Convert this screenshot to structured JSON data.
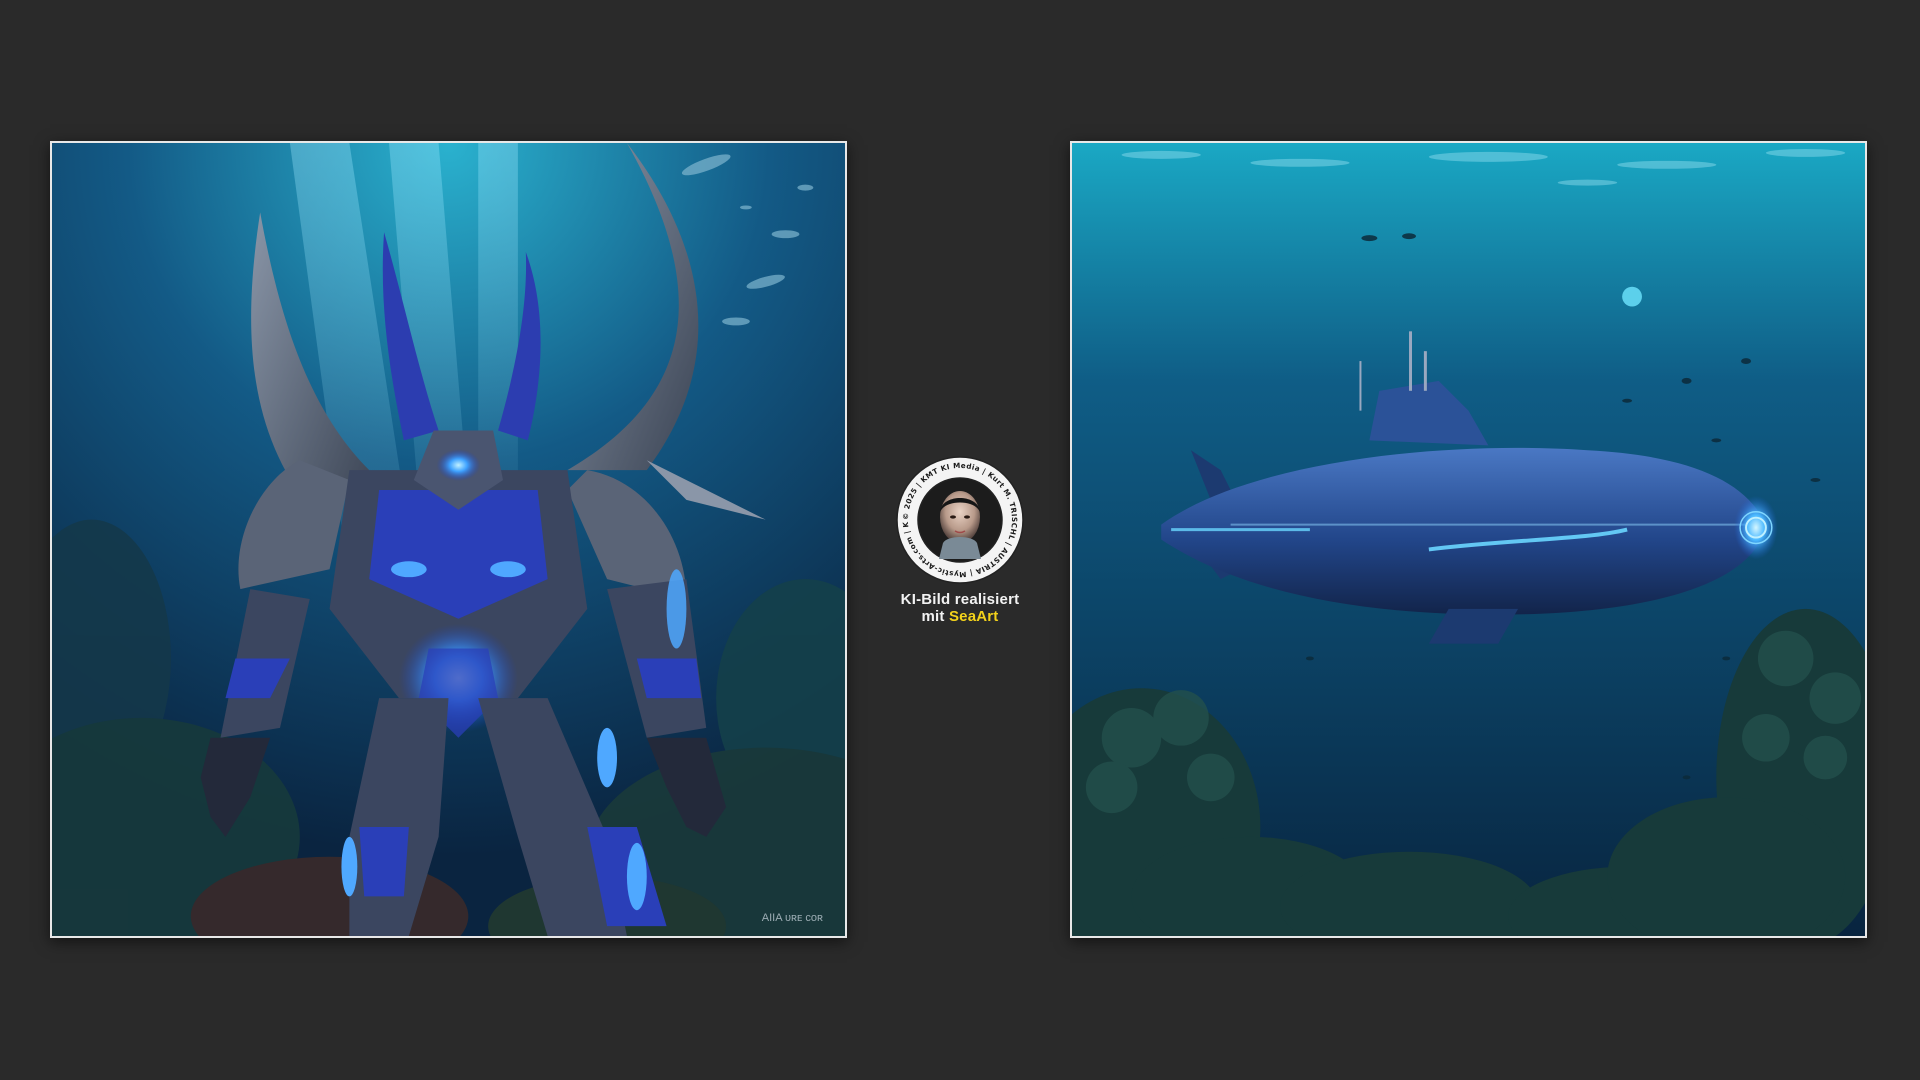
{
  "caption": {
    "line1": "KI-Bild realisiert",
    "line2_prefix": "mit ",
    "line2_brand": "SeaArt"
  },
  "seal": {
    "ring_text": "© 2025 | KMT KI Media | Kurt M. TRISCHL | AUSTRIA | Mystic-Arts.com | KMT.online | AI-Graphic & AI-Music.at |"
  },
  "left_image": {
    "watermark": "AIIA ᴜʀᴇ ᴄᴏʀ"
  },
  "colors": {
    "background": "#2a2a2a",
    "frame_border": "#e8e8e8",
    "brand_yellow": "#f3d21b",
    "ocean_deep": "#0b2a4a",
    "ocean_light": "#1fa8c9",
    "robot_blue": "#2a3fb8",
    "glow_blue": "#4fa8ff"
  }
}
